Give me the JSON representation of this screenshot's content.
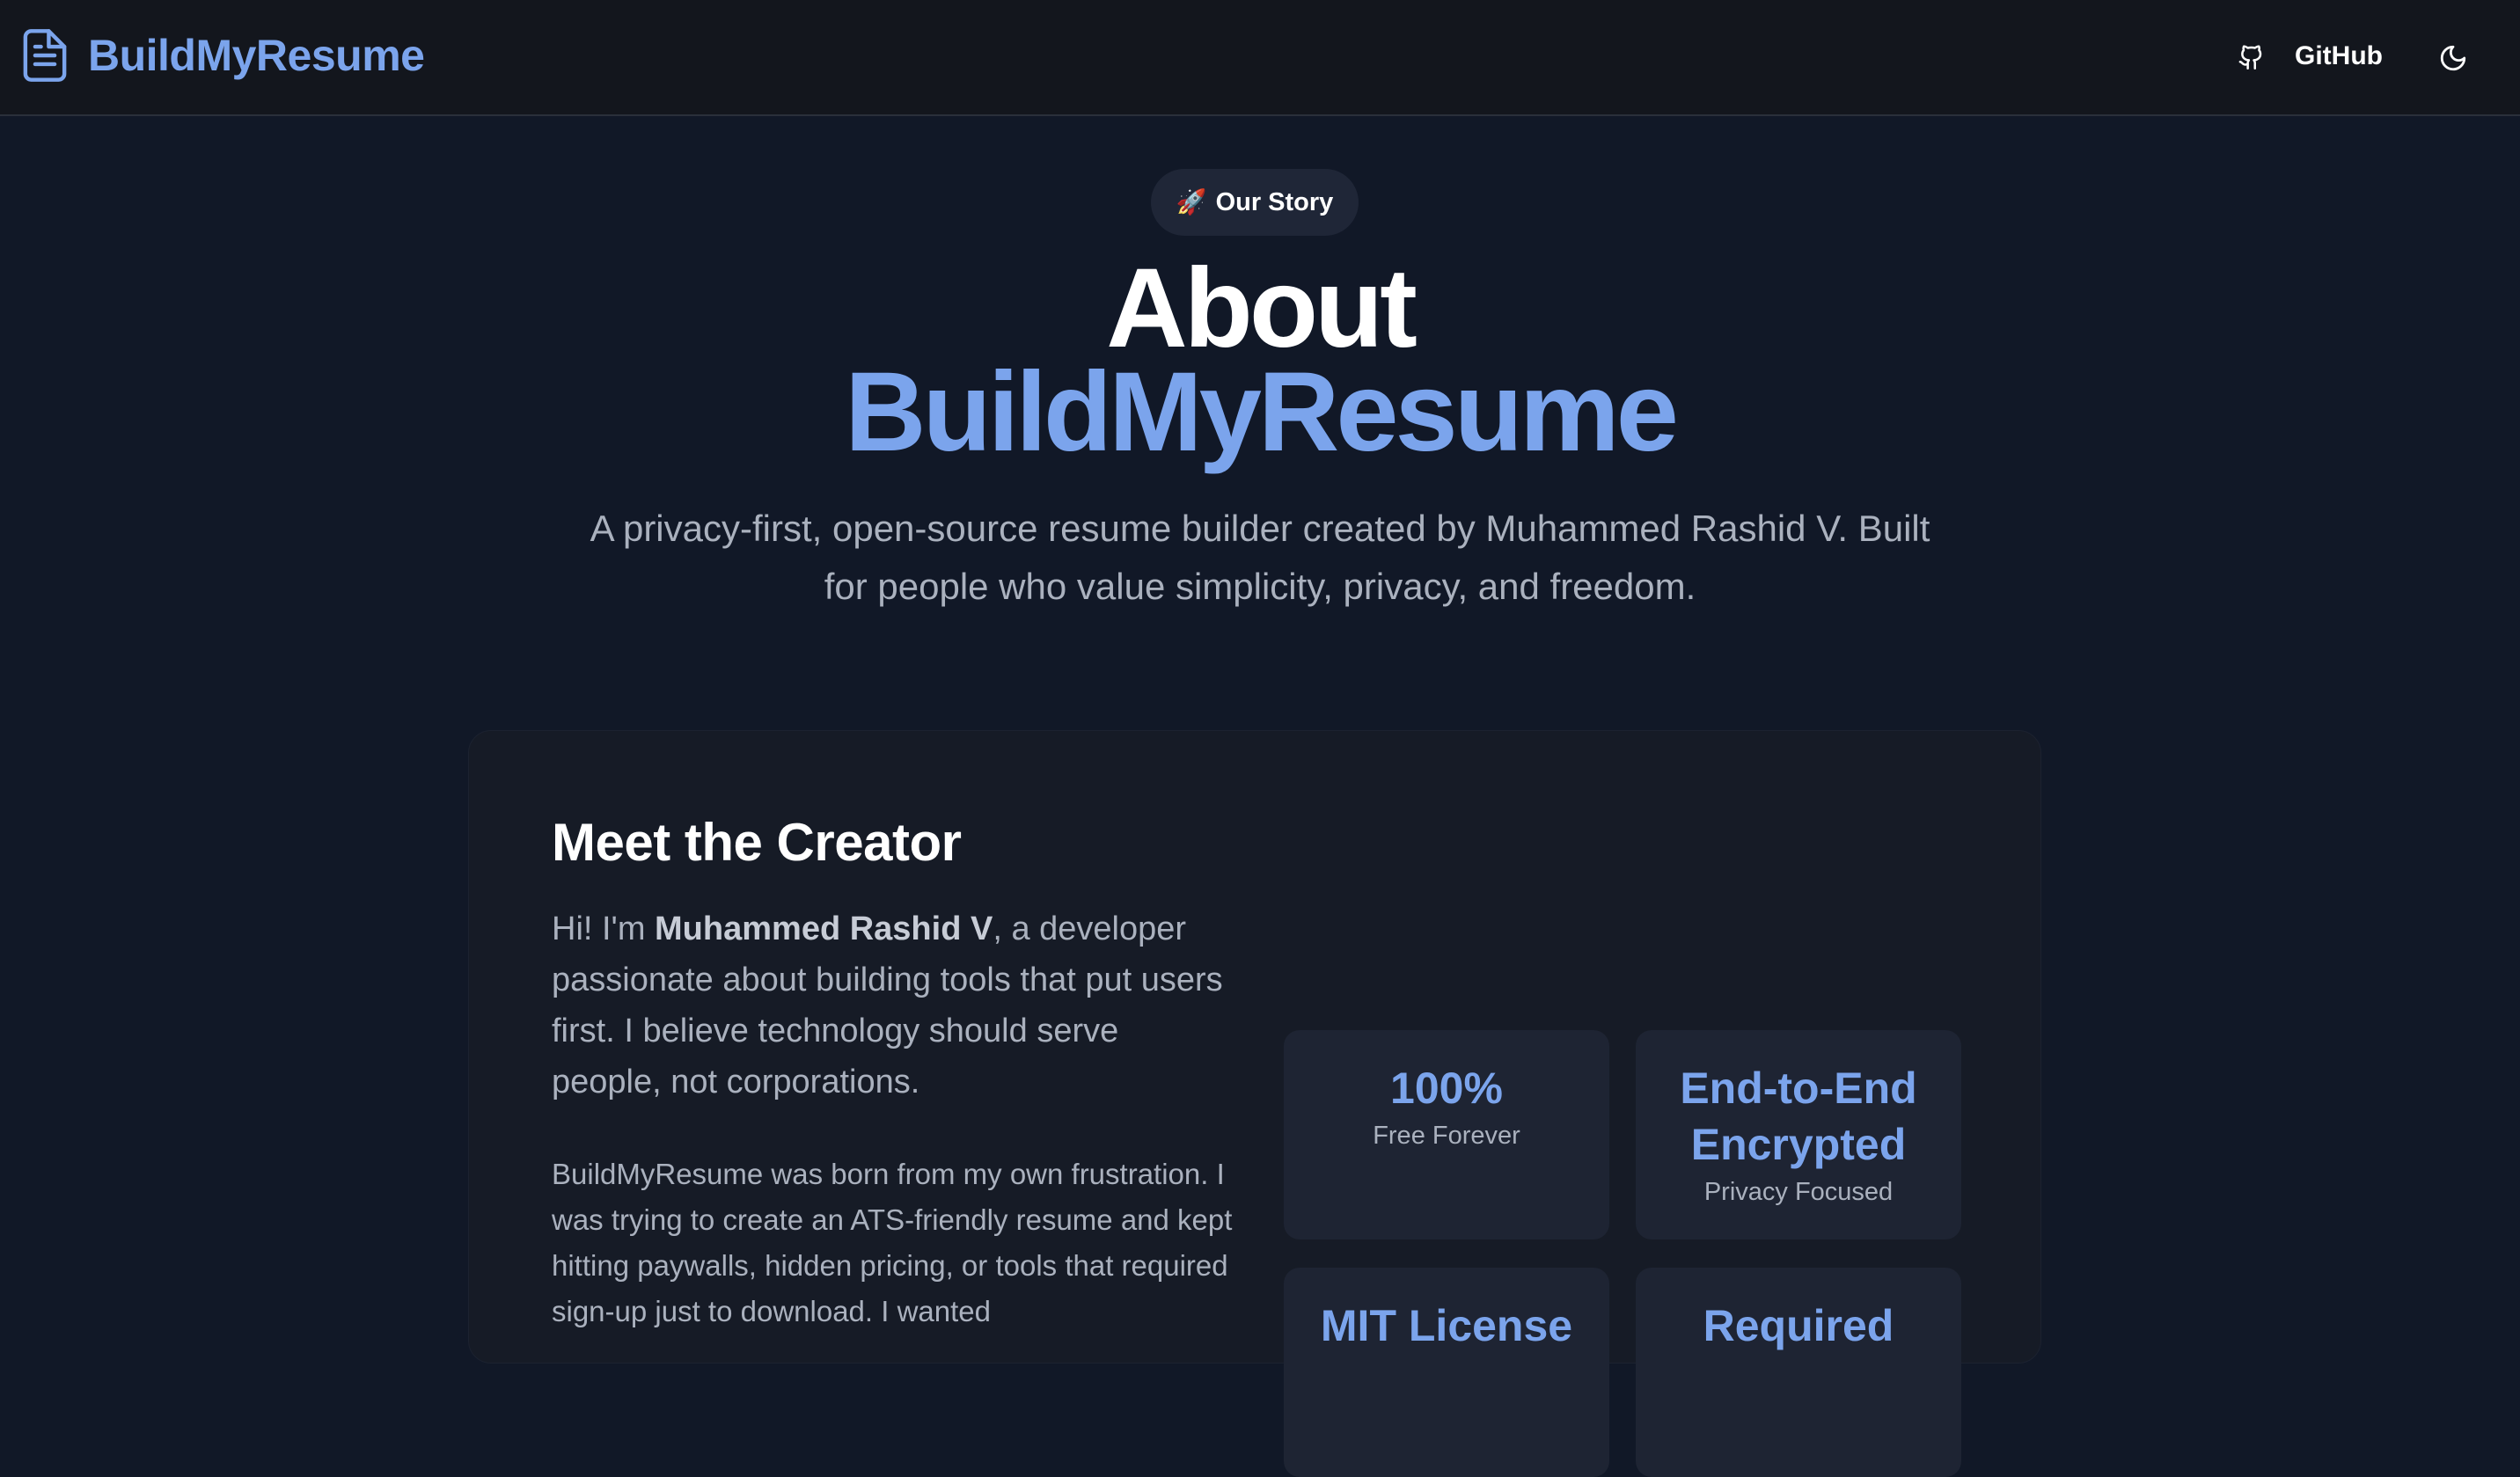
{
  "nav": {
    "brand": "BuildMyResume",
    "github_label": "GitHub",
    "icons": {
      "brand": "document-icon",
      "github": "github-icon",
      "theme": "moon-icon"
    }
  },
  "hero": {
    "badge_emoji": "🚀",
    "badge_label": "Our Story",
    "title_line1": "About",
    "title_line2": "BuildMyResume",
    "subtitle": "A privacy-first, open-source resume builder created by Muhammed Rashid V. Built for people who value simplicity, privacy, and freedom."
  },
  "creator": {
    "heading": "Meet the Creator",
    "intro_prefix": "Hi! I'm ",
    "intro_name": "Muhammed Rashid V",
    "intro_suffix": ", a developer passionate about building tools that put users first. I believe technology should serve people, not corporations.",
    "story": "BuildMyResume was born from my own frustration. I was trying to create an ATS-friendly resume and kept hitting paywalls, hidden pricing, or tools that required sign-up just to download. I wanted"
  },
  "stats": [
    {
      "value": "100%",
      "label": "Free Forever"
    },
    {
      "value": "End-to-End Encrypted",
      "label": "Privacy Focused"
    },
    {
      "value": "MIT License",
      "label": ""
    },
    {
      "value": "Required",
      "label": ""
    }
  ],
  "colors": {
    "background": "#111827",
    "navbar": "#13161d",
    "accent": "#7ba4ec",
    "card": "#161b26",
    "stat_box": "#1e2433",
    "muted_text": "#aab1be"
  }
}
